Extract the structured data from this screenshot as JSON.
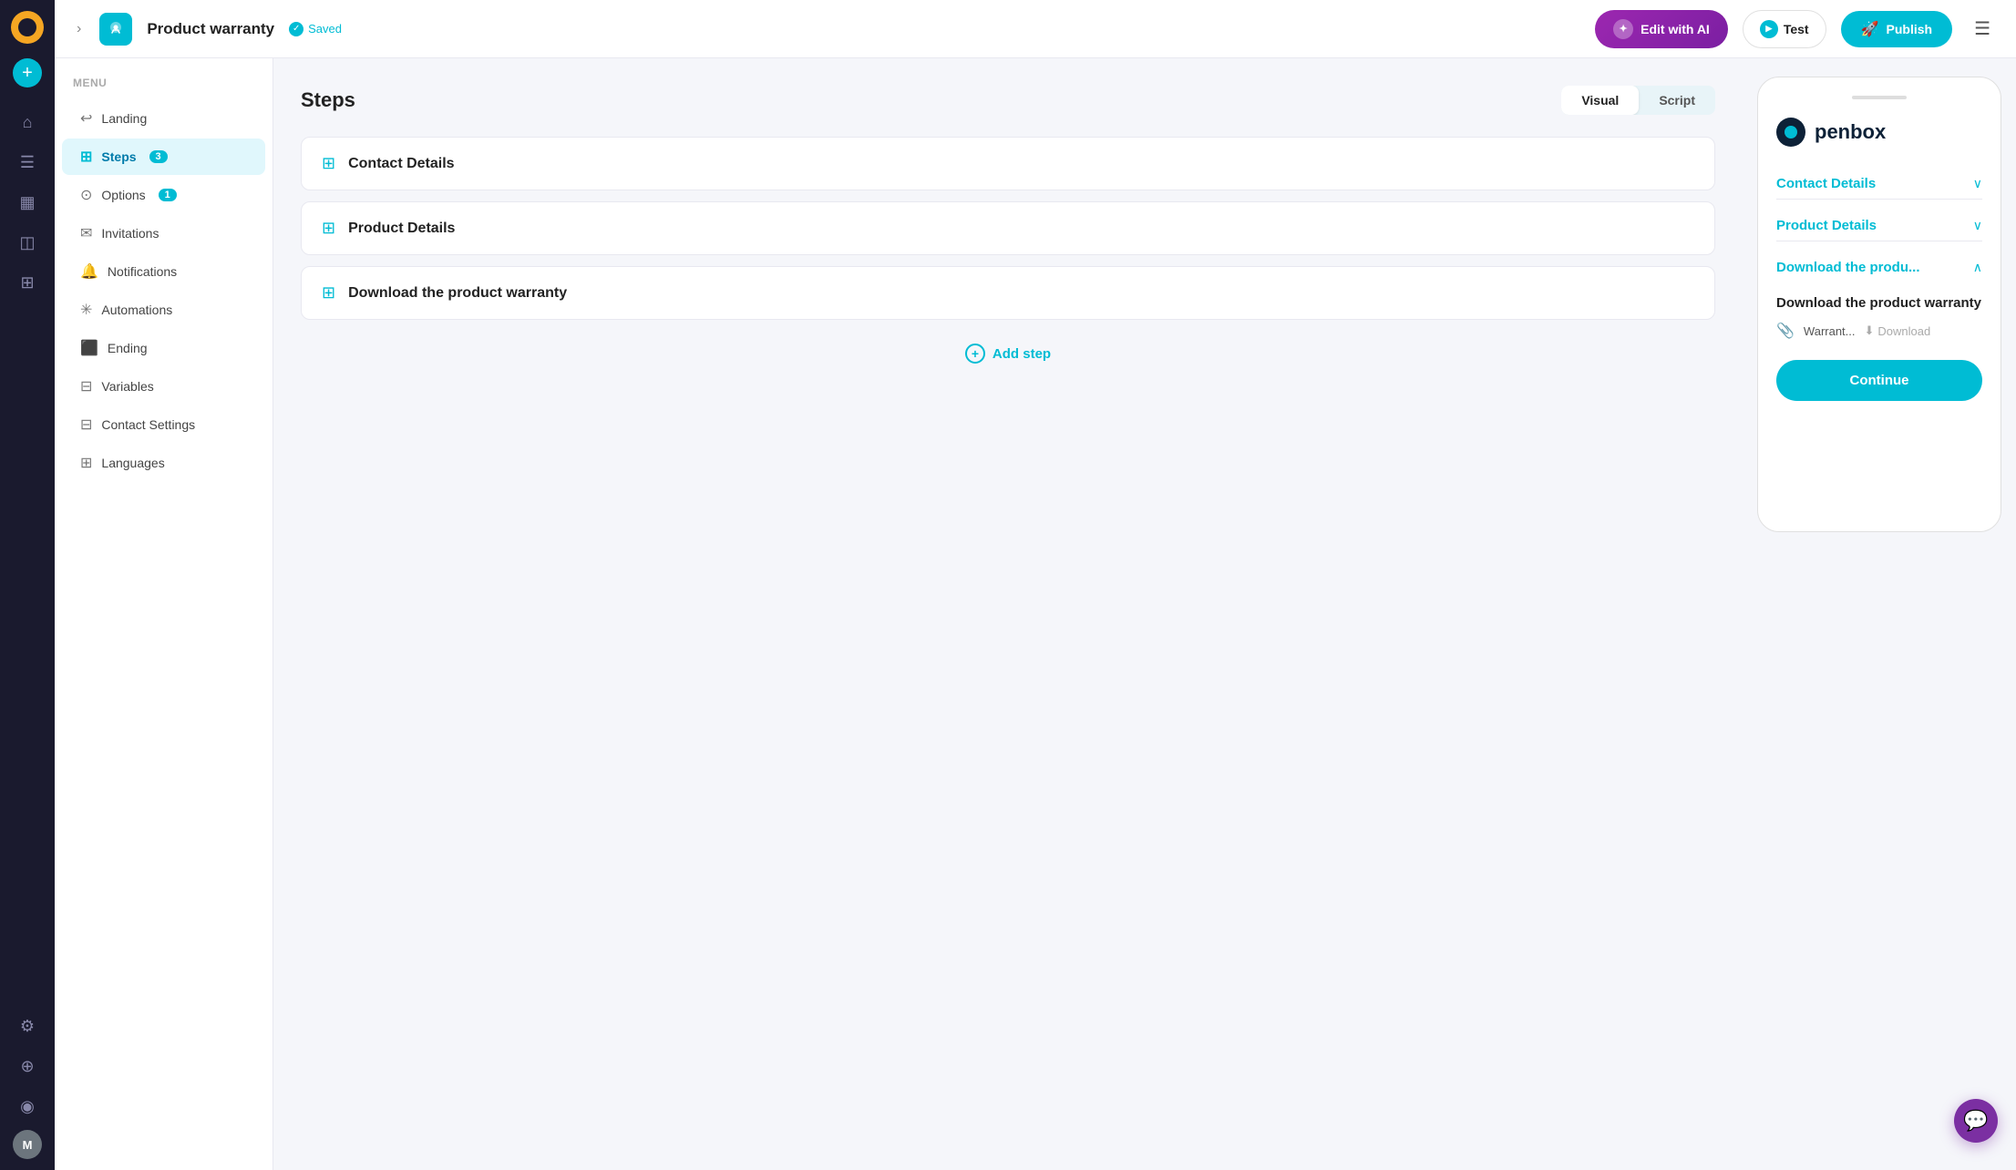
{
  "iconBar": {
    "avatar": "M",
    "navIcons": [
      "⊙",
      "⌂",
      "≡",
      "▦",
      "📁",
      "≡"
    ]
  },
  "topBar": {
    "collapseLabel": "›",
    "appTitle": "Product warranty",
    "savedLabel": "Saved",
    "editAiLabel": "Edit with AI",
    "testLabel": "Test",
    "publishLabel": "Publish",
    "menuLabel": "☰"
  },
  "sidebar": {
    "menuLabel": "Menu",
    "items": [
      {
        "id": "landing",
        "label": "Landing",
        "icon": "↩",
        "active": false,
        "badge": null
      },
      {
        "id": "steps",
        "label": "Steps",
        "icon": "⊞",
        "active": true,
        "badge": "3"
      },
      {
        "id": "options",
        "label": "Options",
        "icon": "⊙",
        "active": false,
        "badge": "1"
      },
      {
        "id": "invitations",
        "label": "Invitations",
        "icon": "✉",
        "active": false,
        "badge": null
      },
      {
        "id": "notifications",
        "label": "Notifications",
        "icon": "🔔",
        "active": false,
        "badge": null
      },
      {
        "id": "automations",
        "label": "Automations",
        "icon": "✳",
        "active": false,
        "badge": null
      },
      {
        "id": "ending",
        "label": "Ending",
        "icon": "⬛",
        "active": false,
        "badge": null
      },
      {
        "id": "variables",
        "label": "Variables",
        "icon": "⊟",
        "active": false,
        "badge": null
      },
      {
        "id": "contact-settings",
        "label": "Contact Settings",
        "icon": "⊟",
        "active": false,
        "badge": null
      },
      {
        "id": "languages",
        "label": "Languages",
        "icon": "⊞",
        "active": false,
        "badge": null
      }
    ]
  },
  "mainPanel": {
    "title": "Steps",
    "viewButtons": [
      {
        "id": "visual",
        "label": "Visual",
        "active": true
      },
      {
        "id": "script",
        "label": "Script",
        "active": false
      }
    ],
    "steps": [
      {
        "id": "contact-details",
        "label": "Contact Details"
      },
      {
        "id": "product-details",
        "label": "Product Details"
      },
      {
        "id": "download-warranty",
        "label": "Download the product warranty"
      }
    ],
    "addStepLabel": "Add step"
  },
  "preview": {
    "brandName": "penbox",
    "sections": [
      {
        "id": "contact-details",
        "title": "Contact Details",
        "expanded": false,
        "content": null
      },
      {
        "id": "product-details",
        "title": "Product Details",
        "expanded": false,
        "content": null
      },
      {
        "id": "download-warranty",
        "title": "Download the produ...",
        "expanded": true,
        "content": {
          "heading": "Download the product warranty",
          "fileName": "Warrant...",
          "downloadLabel": "Download",
          "continueLabel": "Continue"
        }
      }
    ]
  },
  "chat": {
    "icon": "💬"
  }
}
